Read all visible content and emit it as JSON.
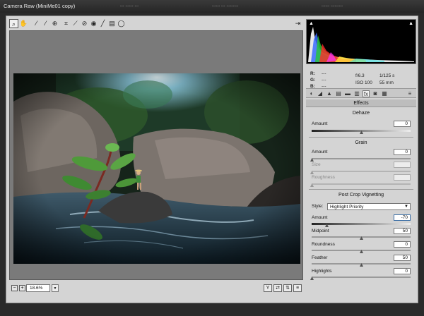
{
  "window": {
    "title": "Camera Raw (MiniMe01 copy)"
  },
  "colors": {
    "title_bg": "#262626",
    "panel_bg": "#d4d4d4",
    "preview_bg": "#7a7a7a"
  },
  "toolbar": {
    "icons": [
      "zoom-icon",
      "hand-icon",
      "white-balance-icon",
      "color-sampler-icon",
      "targeted-adjustment-icon",
      "crop-icon",
      "straighten-icon",
      "spot-removal-icon",
      "red-eye-icon",
      "adjustment-brush-icon",
      "graduated-filter-icon",
      "radial-filter-icon"
    ],
    "right_icon": "open-preferences-icon"
  },
  "bottom": {
    "zoom_value": "18.6%"
  },
  "histogram": {
    "r_label": "R:",
    "g_label": "G:",
    "b_label": "B:",
    "r_value": "---",
    "g_value": "---",
    "b_value": "---",
    "aperture": "f/6.3",
    "shutter": "1/125 s",
    "iso": "ISO 100",
    "focal": "55 mm"
  },
  "panel": {
    "header": "Effects",
    "dehaze": {
      "title": "Dehaze",
      "amount_label": "Amount",
      "amount_value": "0",
      "level": 0.5
    },
    "grain": {
      "title": "Grain",
      "amount_label": "Amount",
      "amount_value": "0",
      "amount_level": 0,
      "size_label": "Size",
      "size_level": 0,
      "roughness_label": "Roughness",
      "roughness_level": 0
    },
    "vignette": {
      "title": "Post Crop Vignetting",
      "style_label": "Style:",
      "style_value": "Highlight Priority",
      "amount_label": "Amount",
      "amount_value": "-70",
      "amount_level": 0.15,
      "midpoint_label": "Midpoint",
      "midpoint_value": "50",
      "midpoint_level": 0.5,
      "roundness_label": "Roundness",
      "roundness_value": "0",
      "roundness_level": 0.5,
      "feather_label": "Feather",
      "feather_value": "50",
      "feather_level": 0.5,
      "highlights_label": "Highlights",
      "highlights_value": "0",
      "highlights_level": 0
    }
  }
}
